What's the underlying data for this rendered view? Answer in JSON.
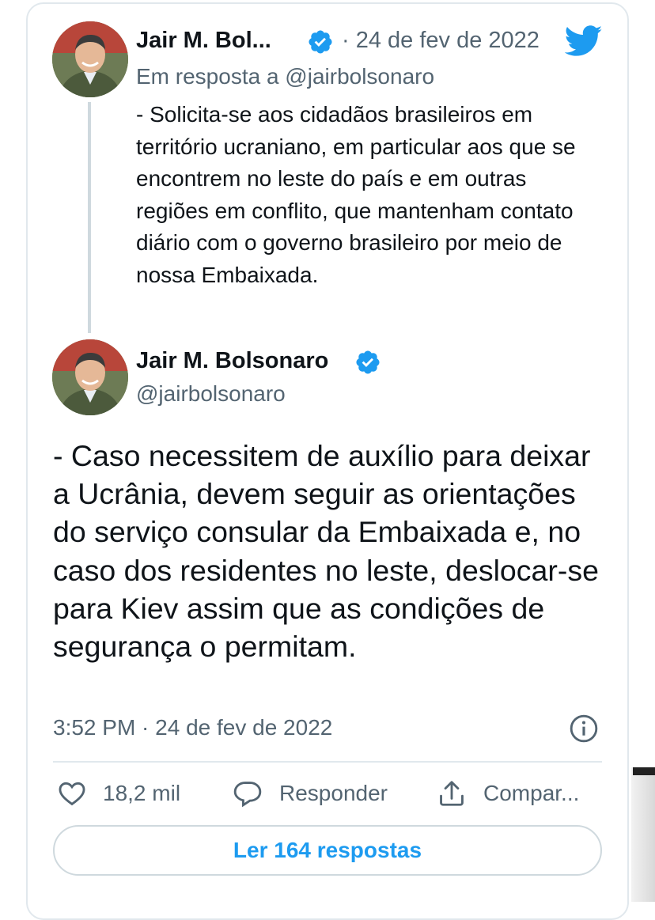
{
  "colors": {
    "accent": "#1d9bf0",
    "text": "#0f1419",
    "muted": "#536471",
    "border": "#e1e8ed"
  },
  "reply_tweet": {
    "author_name": "Jair M. Bol...",
    "date": "· 24 de fev de 2022",
    "in_reply_to": "Em resposta a @jairbolsonaro",
    "text": "- Solicita-se aos cidadãos brasileiros em território ucraniano, em particular aos que se encontrem no leste do país e em outras regiões em conflito, que mantenham contato diário com o governo brasileiro por meio de nossa Embaixada."
  },
  "main_tweet": {
    "author_name": "Jair M. Bolsonaro",
    "handle": "@jairbolsonaro",
    "text": "- Caso necessitem de auxílio para deixar a Ucrânia, devem seguir as orientações do serviço consular da Embaixada e, no caso dos residentes no leste, deslocar-se para Kiev assim que as condições de segurança o permitam.",
    "timestamp": "3:52 PM · 24 de fev de 2022"
  },
  "actions": {
    "likes": "18,2 mil",
    "reply_label": "Responder",
    "share_label": "Compar..."
  },
  "read_replies_label": "Ler 164 respostas",
  "icons": [
    "twitter-bird-icon",
    "verified-badge-icon",
    "info-icon",
    "heart-icon",
    "reply-bubble-icon",
    "share-icon"
  ]
}
